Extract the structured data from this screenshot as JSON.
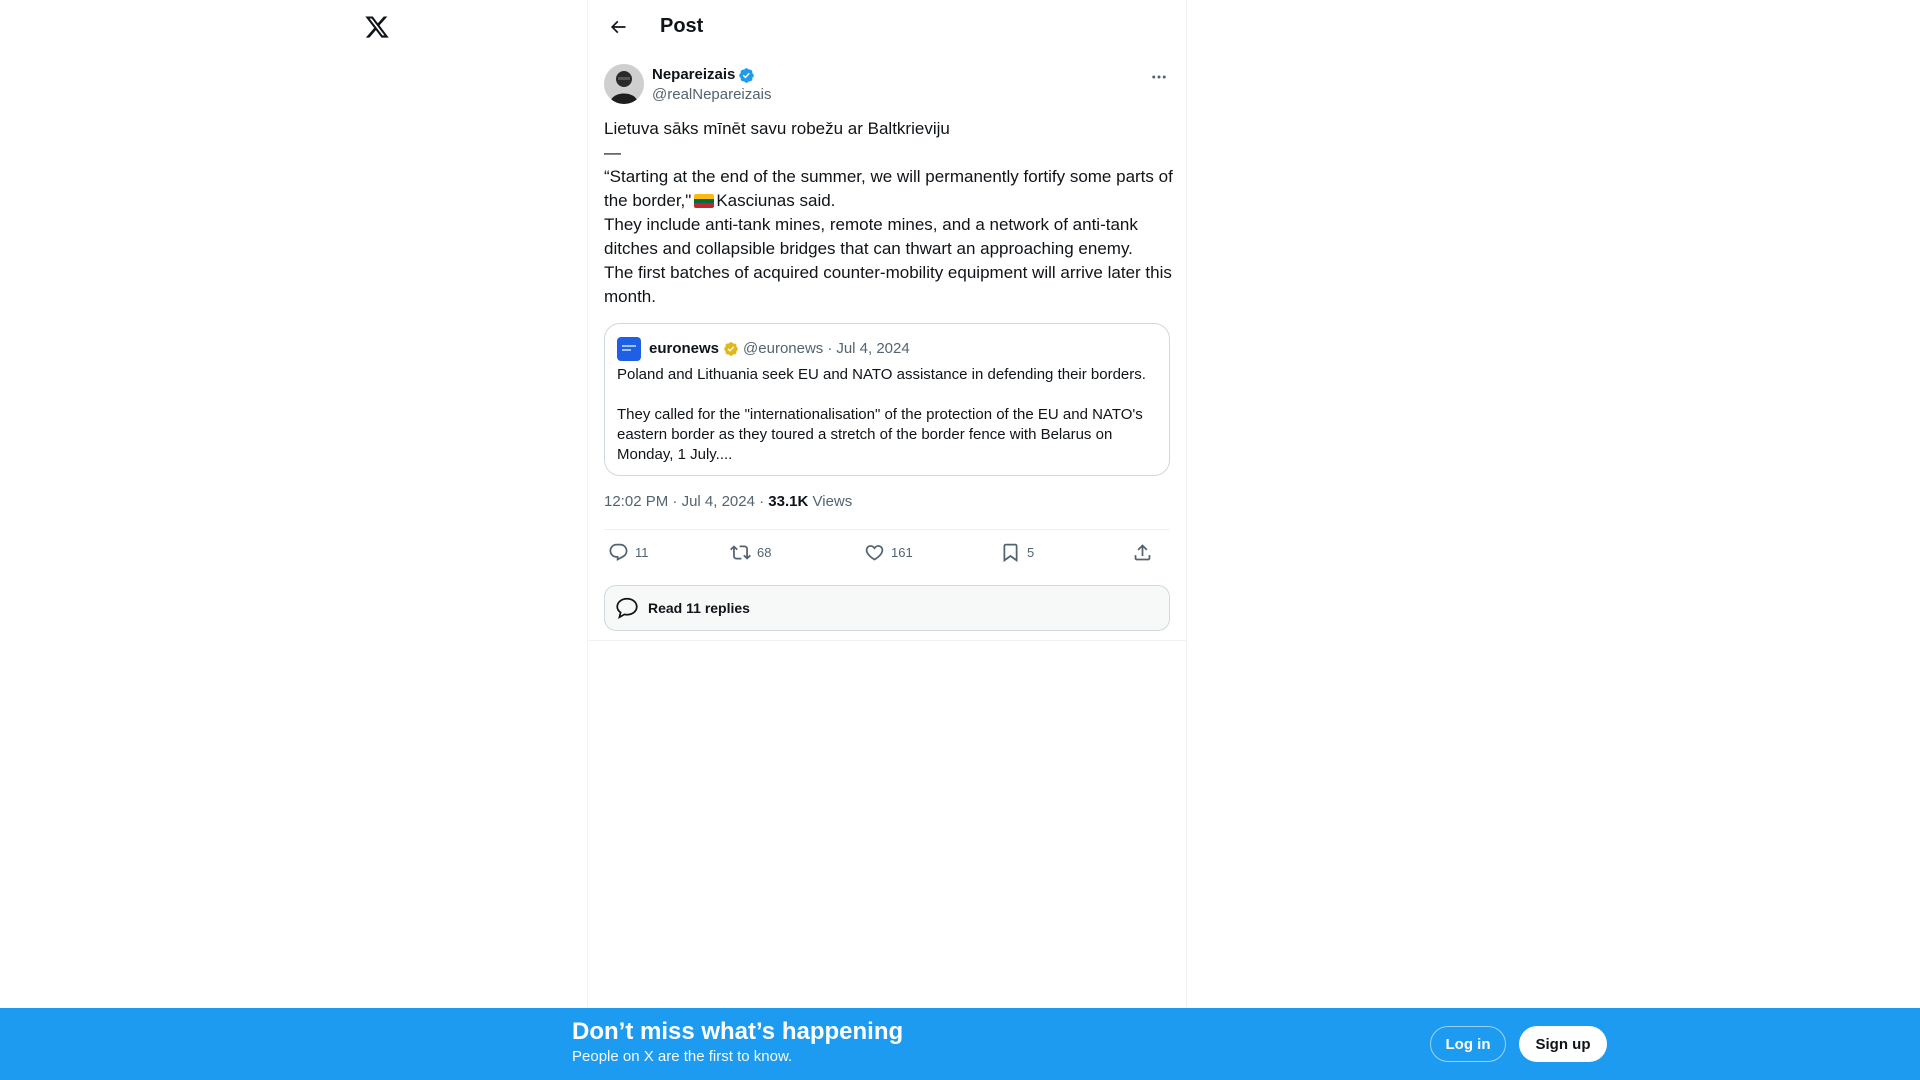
{
  "logo": {
    "icon": "x-logo-icon"
  },
  "header": {
    "title": "Post",
    "back_icon": "arrow-left-icon"
  },
  "author": {
    "name": "Nepareizais",
    "handle": "@realNepareizais",
    "verified_color": "#1d9bf0"
  },
  "tweet": {
    "line1": "Lietuva sāks mīnēt savu robežu ar Baltkrieviju",
    "line2": "—",
    "quote_text_a": "“Starting at the end of the summer, we will permanently fortify some parts of the border,\"",
    "quote_text_b": "Kasciunas said.",
    "line4": "They include anti-tank mines, remote mines, and a network of anti-tank ditches and collapsible bridges that can thwart an approaching enemy.",
    "line5": "The first batches of acquired counter-mobility equipment will arrive later this month."
  },
  "quoted": {
    "name": "euronews",
    "handle": "@euronews",
    "separator": "·",
    "date": "Jul 4, 2024",
    "para1": "Poland and Lithuania seek EU and NATO assistance in defending their borders.",
    "para2": "They called for the \"internationalisation\" of the protection of the EU and NATO's eastern border as they toured a stretch of the border fence with Belarus on Monday, 1 July...."
  },
  "meta": {
    "time": "12:02 PM",
    "separator": "·",
    "date": "Jul 4, 2024",
    "views_count": "33.1K",
    "views_label": "Views"
  },
  "actions": {
    "replies": "11",
    "reposts": "68",
    "likes": "161",
    "bookmarks": "5"
  },
  "read_replies": {
    "label": "Read 11 replies"
  },
  "banner": {
    "title": "Don’t miss what’s happening",
    "subtitle": "People on X are the first to know.",
    "login": "Log in",
    "signup": "Sign up",
    "color": "#1d9bf0"
  }
}
